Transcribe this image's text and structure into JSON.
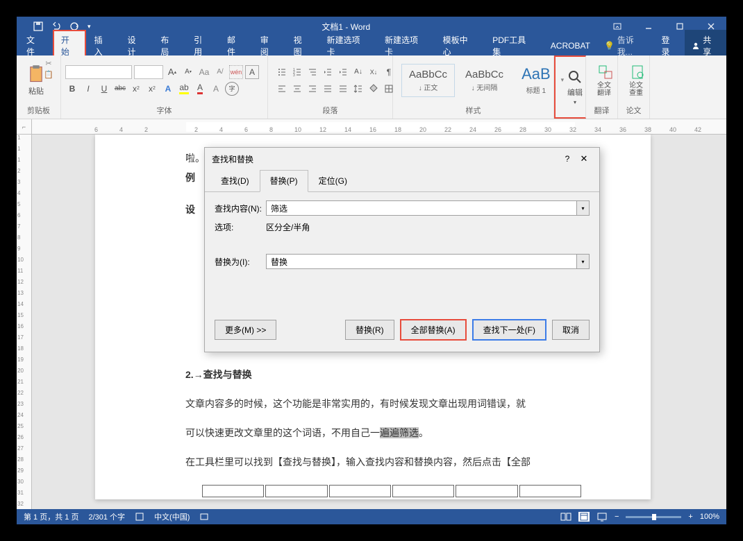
{
  "app": {
    "title": "文档1 - Word"
  },
  "tabs": {
    "file": "文件",
    "home": "开始",
    "insert": "插入",
    "design": "设计",
    "layout": "布局",
    "references": "引用",
    "mail": "邮件",
    "review": "审阅",
    "view": "视图",
    "newtab1": "新建选项卡",
    "newtab2": "新建选项卡",
    "template": "模板中心",
    "pdf": "PDF工具集",
    "acrobat": "ACROBAT",
    "tellme": "告诉我...",
    "login": "登录",
    "share": "共享"
  },
  "ribbon": {
    "clipboard": {
      "label": "剪贴板",
      "paste": "粘贴"
    },
    "font": {
      "label": "字体"
    },
    "paragraph": {
      "label": "段落"
    },
    "styles": {
      "label": "样式",
      "normal": {
        "preview": "AaBbCc",
        "name": "↓ 正文"
      },
      "nospace": {
        "preview": "AaBbCc",
        "name": "↓ 无间隔"
      },
      "heading1": {
        "preview": "AaB",
        "name": "标题 1"
      }
    },
    "edit": {
      "label": "编辑"
    },
    "translate": {
      "label": "翻译",
      "full": "全文翻译"
    },
    "paper": {
      "label": "论文",
      "check": "论文查重"
    }
  },
  "ruler": {
    "h": [
      "6",
      "4",
      "2",
      "",
      "2",
      "4",
      "6",
      "8",
      "10",
      "12",
      "14",
      "16",
      "18",
      "20",
      "22",
      "24",
      "26",
      "28",
      "30",
      "32",
      "34",
      "36",
      "38",
      "40",
      "42"
    ],
    "v": [
      "1",
      "1",
      "1",
      "2",
      "3",
      "4",
      "5",
      "6",
      "7",
      "8",
      "9",
      "10",
      "11",
      "12",
      "13",
      "14",
      "15",
      "16",
      "17",
      "18",
      "19",
      "20",
      "21",
      "22",
      "23",
      "24",
      "25",
      "26",
      "27",
      "28",
      "29",
      "30",
      "31",
      "32",
      "33"
    ]
  },
  "document": {
    "line1": "啦。",
    "line2": "例",
    "line3": "设",
    "heading": "2.→查找与替换",
    "para1_a": "文章内容多的时候，这个功能是非常实用的，有时候发现文章出现用词错误，就",
    "para2_a": "可以快速更改文章里的这个词语，不用自己一",
    "para2_hl": "遍遍筛选",
    "para2_b": "。",
    "para3": "在工具栏里可以找到【查找与替换】，输入查找内容和替换内容，然后点击【全部"
  },
  "dialog": {
    "title": "查找和替换",
    "tabs": {
      "find": "查找(D)",
      "replace": "替换(P)",
      "goto": "定位(G)"
    },
    "find_label": "查找内容(N):",
    "find_value": "筛选",
    "options_label": "选项:",
    "options_value": "区分全/半角",
    "replace_label": "替换为(I):",
    "replace_value": "替换",
    "more": "更多(M) >>",
    "btn_replace": "替换(R)",
    "btn_replace_all": "全部替换(A)",
    "btn_find_next": "查找下一处(F)",
    "btn_cancel": "取消"
  },
  "status": {
    "page": "第 1 页，共 1 页",
    "words": "2/301 个字",
    "lang": "中文(中国)",
    "zoom": "100%"
  }
}
